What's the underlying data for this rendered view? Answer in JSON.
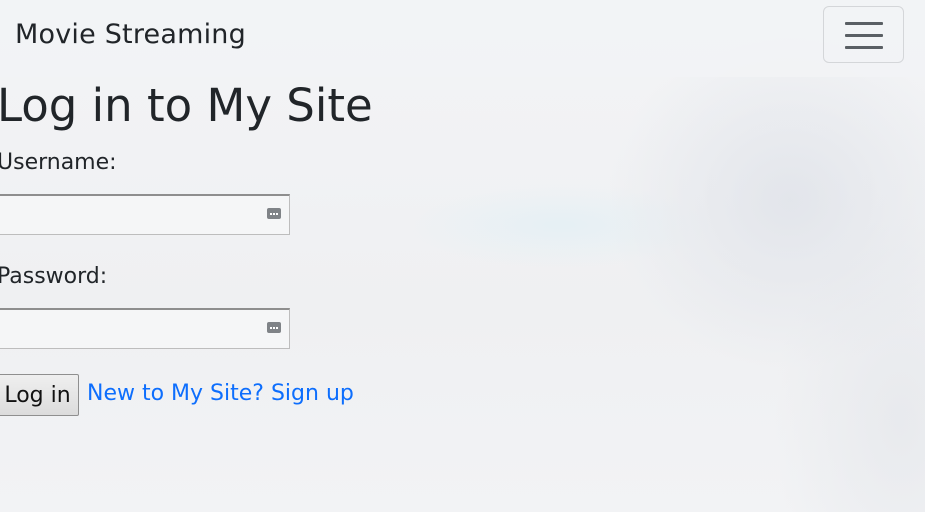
{
  "navbar": {
    "brand": "Movie Streaming",
    "toggle_icon": "hamburger-menu-icon"
  },
  "login": {
    "title": "Log in to My Site",
    "username_label": "Username:",
    "username_value": "",
    "password_label": "Password:",
    "password_value": "",
    "field_icon": "password-manager-key-icon",
    "submit_label": "Log in",
    "signup_text": "New to My Site? Sign up"
  },
  "colors": {
    "link": "#0d6efd",
    "text": "#212529",
    "navbar_bg": "#f2f3f5"
  }
}
